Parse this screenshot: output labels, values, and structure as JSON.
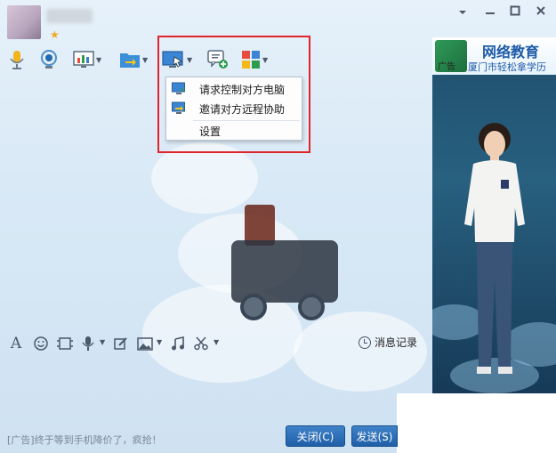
{
  "title_bar": {
    "window_controls": [
      "minimize-arrow",
      "minimize",
      "maximize",
      "close"
    ]
  },
  "toolbar": {
    "items": [
      {
        "name": "voice-call",
        "icon": "microphone-icon"
      },
      {
        "name": "video-call",
        "icon": "camera-icon"
      },
      {
        "name": "screen-share",
        "icon": "monitor-chart-icon",
        "has_dropdown": true
      },
      {
        "name": "send-file",
        "icon": "folder-arrow-icon",
        "has_dropdown": true
      },
      {
        "name": "remote-assist",
        "icon": "remote-desktop-icon",
        "has_dropdown": true,
        "active": true
      },
      {
        "name": "new-discussion",
        "icon": "chat-add-icon"
      },
      {
        "name": "apps",
        "icon": "app-grid-icon",
        "has_dropdown": true
      }
    ]
  },
  "remote_menu": {
    "items": [
      {
        "label": "请求控制对方电脑",
        "icon": "remote-request-icon"
      },
      {
        "label": "邀请对方远程协助",
        "icon": "remote-invite-icon"
      },
      {
        "label": "设置",
        "icon": ""
      }
    ]
  },
  "ad_panel": {
    "label": "广告",
    "title": "网络教育",
    "subtitle": "厦门市轻松拿学历"
  },
  "input_toolbar": {
    "icons": [
      "font-icon",
      "emoji-icon",
      "screenshot-icon",
      "voice-message-icon",
      "edit-icon",
      "image-icon",
      "music-icon",
      "scissors-icon"
    ],
    "history_label": "消息记录"
  },
  "bottom": {
    "ad_text": "[广告]终于等到手机降价了，疯抢！",
    "close_label": "关闭(C)",
    "send_label": "发送(S)"
  },
  "colors": {
    "accent_blue": "#1f5fa8",
    "highlight_red": "#e0242a",
    "window_bg": "#dbe9f6"
  }
}
